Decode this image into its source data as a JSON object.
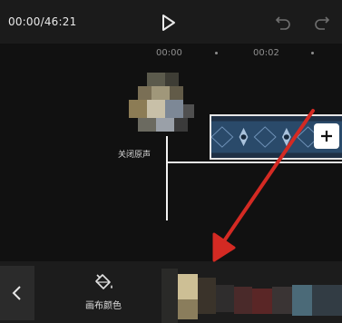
{
  "player": {
    "time": "00:00/46:21"
  },
  "ruler": {
    "ticks": [
      "00:00",
      "00:02"
    ]
  },
  "track": {
    "mute_label": "关闭原声"
  },
  "toolbar": {
    "canvas_color_label": "画布颜色"
  },
  "icons": {
    "play": "play-icon",
    "undo": "undo-icon",
    "redo": "redo-icon",
    "add": "plus-icon",
    "back": "chevron-left-icon",
    "canvas_color": "paint-bucket-icon"
  },
  "colors": {
    "annotation_arrow": "#d42a23",
    "background": "#111111"
  }
}
